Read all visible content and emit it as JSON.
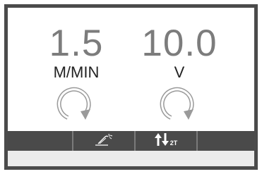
{
  "left_display": {
    "value": "1.5",
    "unit": "M/MIN",
    "icon": "wire-speed-knob-icon"
  },
  "right_display": {
    "value": "10.0",
    "unit": "V",
    "icon": "voltage-knob-icon"
  },
  "status_bar": {
    "segments": [
      {
        "id": "empty-1",
        "icon": ""
      },
      {
        "id": "torch",
        "icon": "welding-torch-icon"
      },
      {
        "id": "trigger-mode",
        "icon": "up-down-arrows-icon",
        "label": "2T"
      },
      {
        "id": "empty-4",
        "icon": ""
      }
    ]
  },
  "colors": {
    "frame": "#4b4b4b",
    "readout": "#7c7c7c",
    "bar": "#4a4a4a"
  }
}
